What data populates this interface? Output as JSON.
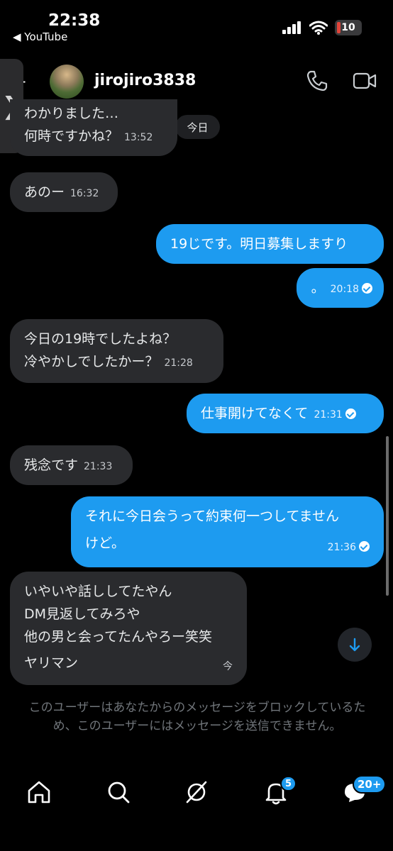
{
  "status_bar": {
    "time": "22:38",
    "back_app": "◀ YouTube",
    "battery": "10"
  },
  "header": {
    "username": "jirojiro3838",
    "back_glyph": "-"
  },
  "date_pill": "今日",
  "messages": [
    {
      "side": "received",
      "lines": [
        "わかりました…",
        "何時ですかね？"
      ],
      "time": "13:52"
    },
    {
      "side": "received",
      "lines": [
        "あのー"
      ],
      "time": "16:32"
    },
    {
      "side": "sent",
      "lines": [
        "19じです。明日募集しますり"
      ],
      "time": ""
    },
    {
      "side": "sent",
      "lines": [
        "。"
      ],
      "time": "20:18"
    },
    {
      "side": "received",
      "lines": [
        "今日の19時でしたよね？",
        "冷やかしでしたかー？"
      ],
      "time": "21:28"
    },
    {
      "side": "sent",
      "lines": [
        "仕事開けてなくて"
      ],
      "time": "21:31"
    },
    {
      "side": "received",
      "lines": [
        "残念です"
      ],
      "time": "21:33"
    },
    {
      "side": "sent",
      "lines": [
        "それに今日会うって約束何一つしてません",
        "けど。"
      ],
      "time": "21:36"
    },
    {
      "side": "received",
      "lines": [
        "いやいや話ししてたやん",
        "DM見返してみろや",
        "他の男と会ってたんやろー笑笑",
        "ヤリマン"
      ],
      "time": "今"
    }
  ],
  "blocked_notice": "このユーザーはあなたからのメッセージをブロックしているため、このユーザーにはメッセージを送信できません。",
  "nav": {
    "notifications_badge": "5",
    "messages_badge": "20+"
  }
}
